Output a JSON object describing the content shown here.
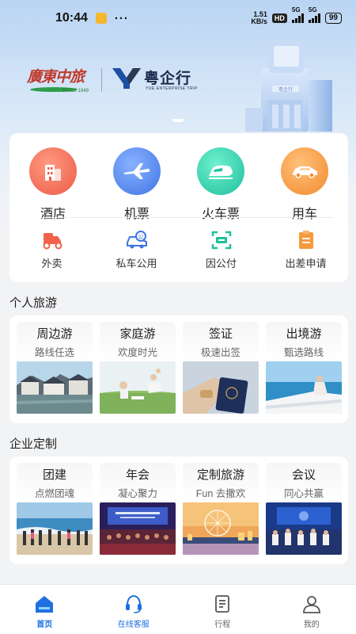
{
  "status_bar": {
    "time": "10:44",
    "dots": "···",
    "net_speed_value": "1.51",
    "net_speed_unit": "KB/s",
    "hd": "HD",
    "sig1": "5G",
    "sig2": "5G",
    "battery": "99"
  },
  "banner": {
    "logo_left_text": "廣東中旅",
    "logo_left_since": "SINCE 1949",
    "logo_right_name": "粤企行",
    "logo_right_sub": "YUE ENTERPRISE TRIP",
    "building_sign": "粤企行"
  },
  "services": {
    "main": [
      {
        "label": "酒店",
        "icon": "hotel-icon",
        "color": "#f06b55"
      },
      {
        "label": "机票",
        "icon": "plane-icon",
        "color": "#4a82ea"
      },
      {
        "label": "火车票",
        "icon": "train-icon",
        "color": "#2fc8a6"
      },
      {
        "label": "用车",
        "icon": "car-icon",
        "color": "#f59a3d"
      }
    ],
    "sub": [
      {
        "label": "外卖",
        "icon": "delivery-icon"
      },
      {
        "label": "私车公用",
        "icon": "private-car-icon"
      },
      {
        "label": "因公付",
        "icon": "scan-pay-icon"
      },
      {
        "label": "出差申请",
        "icon": "application-icon"
      }
    ]
  },
  "personal_travel": {
    "title": "个人旅游",
    "tiles": [
      {
        "title": "周边游",
        "subtitle": "路线任选"
      },
      {
        "title": "家庭游",
        "subtitle": "欢度时光"
      },
      {
        "title": "签证",
        "subtitle": "极速出签"
      },
      {
        "title": "出境游",
        "subtitle": "甄选路线"
      }
    ]
  },
  "enterprise_custom": {
    "title": "企业定制",
    "tiles": [
      {
        "title": "团建",
        "subtitle": "点燃团魂"
      },
      {
        "title": "年会",
        "subtitle": "凝心聚力"
      },
      {
        "title": "定制旅游",
        "subtitle": "Fun 去撒欢"
      },
      {
        "title": "会议",
        "subtitle": "同心共赢"
      }
    ]
  },
  "bottom_nav": [
    {
      "label": "首页",
      "icon": "home-icon"
    },
    {
      "label": "在线客服",
      "icon": "headset-icon"
    },
    {
      "label": "行程",
      "icon": "itinerary-icon"
    },
    {
      "label": "我的",
      "icon": "profile-icon"
    }
  ],
  "colors": {
    "accent": "#1f6fe0",
    "hotel": "#f06b55",
    "flight": "#4a82ea",
    "train": "#2fc8a6",
    "car": "#f59a3d"
  }
}
